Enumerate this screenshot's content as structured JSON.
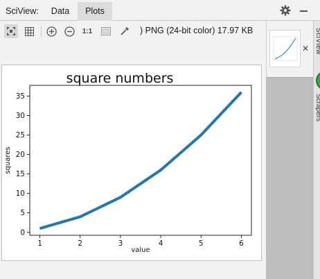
{
  "app": {
    "title": "SciView:",
    "tabs": [
      {
        "label": "Data"
      },
      {
        "label": "Plots"
      }
    ]
  },
  "toolbar": {
    "ratio_label": "1:1",
    "file_info": ") PNG (24-bit color) 17.97 KB"
  },
  "side_strip": {
    "top_text": "SciView",
    "bottom_text": "Scrapers"
  },
  "colors": {
    "line": "#1f77b4",
    "accent_green": "#2fae3a"
  },
  "icons": [
    "fit-icon",
    "grid-icon",
    "zoom-in-icon",
    "zoom-out-icon",
    "background-icon",
    "eyedropper-icon",
    "gear-icon",
    "minimize-icon",
    "close-icon"
  ],
  "chart_data": {
    "type": "line",
    "title": "square numbers",
    "xlabel": "value",
    "ylabel": "squares",
    "x": [
      1,
      2,
      3,
      4,
      5,
      6
    ],
    "series": [
      {
        "values": [
          1,
          4,
          9,
          16,
          25,
          36
        ]
      }
    ],
    "xticks": [
      "1",
      "2",
      "3",
      "4",
      "5",
      "6"
    ],
    "yticks": [
      "0",
      "5",
      "10",
      "15",
      "20",
      "25",
      "30",
      "35"
    ],
    "xlim": [
      0.75,
      6.25
    ],
    "ylim": [
      -0.75,
      37.75
    ],
    "grid": false
  }
}
